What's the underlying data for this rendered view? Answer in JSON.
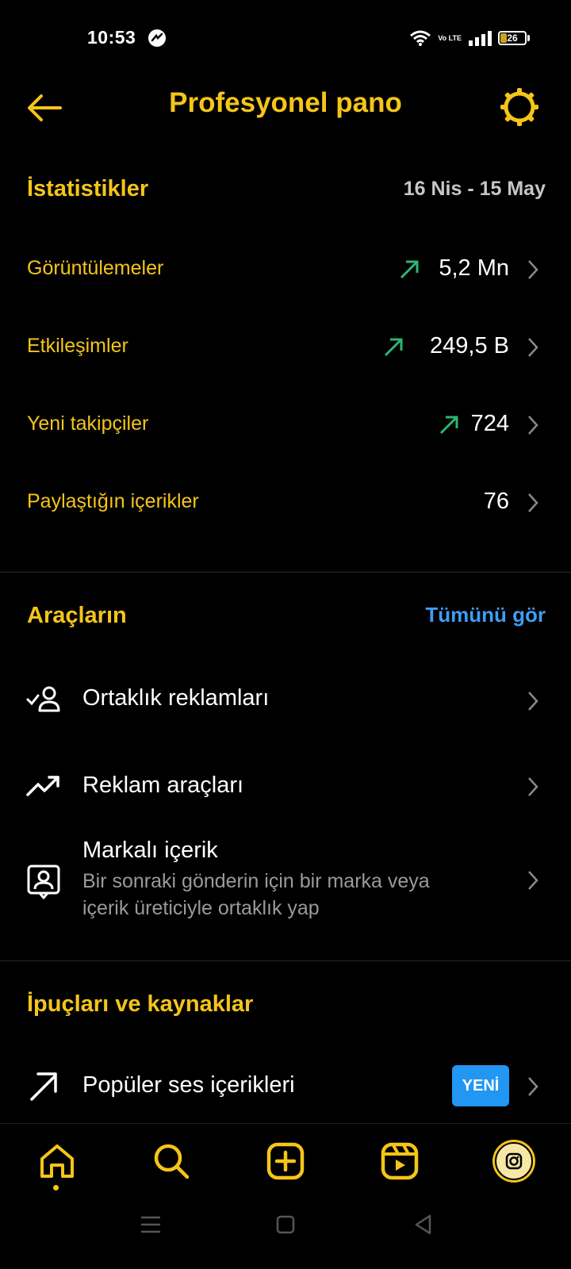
{
  "status_bar": {
    "time": "10:53",
    "network": "Vo LTE",
    "battery": "26",
    "battery_level": 0.26
  },
  "header": {
    "title": "Profesyonel pano",
    "back_icon": "arrow-left-icon",
    "settings_icon": "gear-icon"
  },
  "stats": {
    "title": "İstatistikler",
    "date_range": "16 Nis - 15 May",
    "rows": [
      {
        "label": "Görüntülemeler",
        "value": "5,2 Mn",
        "trend": "up"
      },
      {
        "label": "Etkileşimler",
        "value": "249,5 B",
        "trend": "up"
      },
      {
        "label": "Yeni takipçiler",
        "value": "724",
        "trend": "up"
      },
      {
        "label": "Paylaştığın içerikler",
        "value": "76",
        "trend": "none"
      }
    ]
  },
  "tools": {
    "title": "Araçların",
    "see_all": "Tümünü gör",
    "items": [
      {
        "label": "Ortaklık reklamları",
        "icon": "partnership-icon"
      },
      {
        "label": "Reklam araçları",
        "icon": "trending-up-icon"
      },
      {
        "label": "Markalı içerik",
        "subtitle": "Bir sonraki gönderin için bir marka veya içerik üreticiyle ortaklık yap",
        "icon": "branded-content-icon"
      }
    ]
  },
  "tips": {
    "title": "İpuçları ve kaynaklar",
    "items": [
      {
        "label": "Popüler ses içerikleri",
        "badge": "YENİ",
        "icon": "arrow-up-right-icon"
      }
    ]
  },
  "bottom_nav": [
    "home-icon",
    "search-icon",
    "create-icon",
    "reels-icon",
    "profile-avatar"
  ],
  "colors": {
    "accent": "#f5c518",
    "trend_up": "#2bb673",
    "link": "#3f9cf5",
    "badge": "#2196f3"
  }
}
